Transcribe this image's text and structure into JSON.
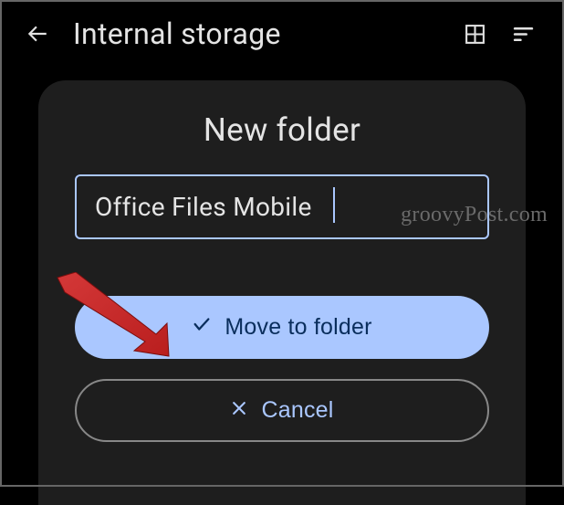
{
  "header": {
    "title": "Internal storage"
  },
  "dialog": {
    "title": "New folder",
    "input_value": "Office Files Mobile",
    "primary_action": "Move to folder",
    "secondary_action": "Cancel"
  },
  "watermark": "groovyPost.com"
}
